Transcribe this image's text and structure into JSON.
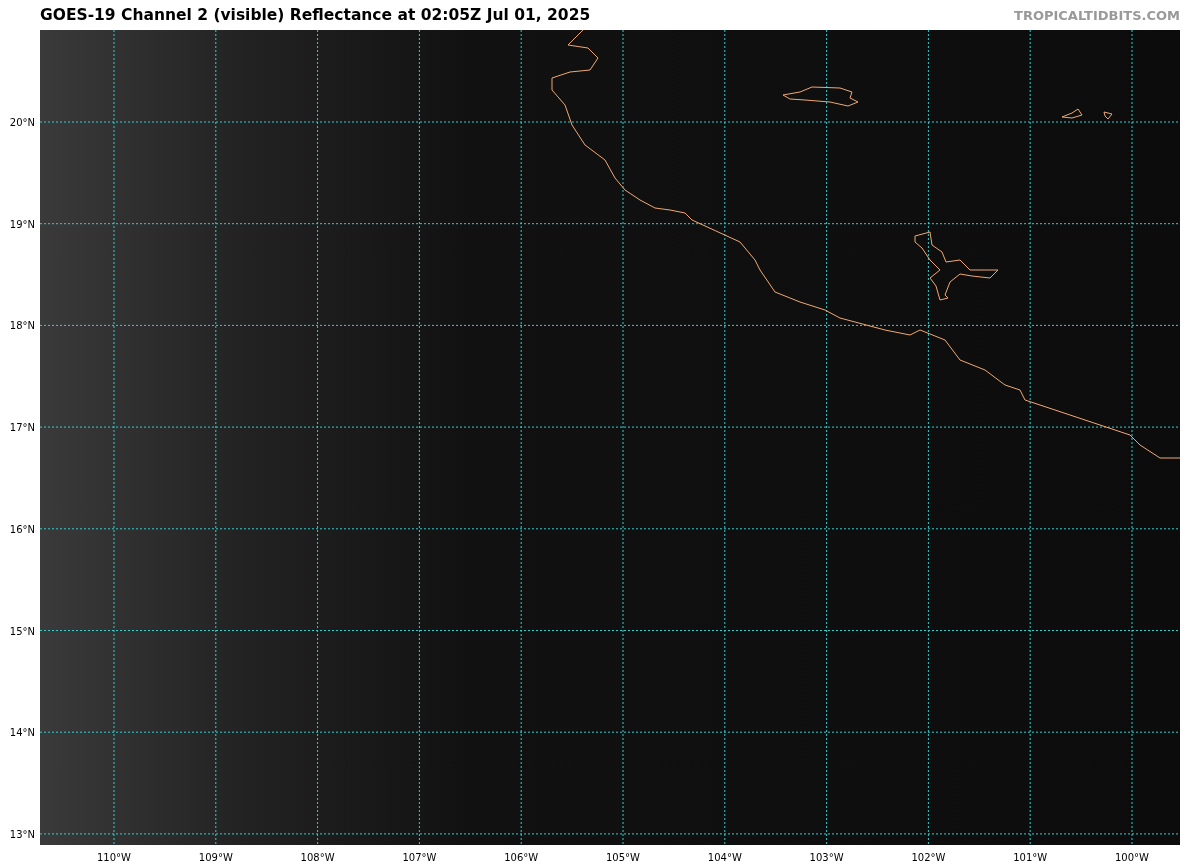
{
  "title": "GOES-19 Channel 2 (visible) Reflectance at 02:05Z Jul 01, 2025",
  "credit": "TROPICALTIDBITS.COM",
  "map": {
    "lat_labels": [
      "20°N",
      "19°N",
      "18°N",
      "17°N",
      "16°N",
      "15°N",
      "14°N",
      "13°N"
    ],
    "lon_labels": [
      "110°W",
      "109°W",
      "108°W",
      "107°W",
      "106°W",
      "105°W",
      "104°W",
      "103°W",
      "102°W",
      "101°W",
      "100°W"
    ]
  }
}
